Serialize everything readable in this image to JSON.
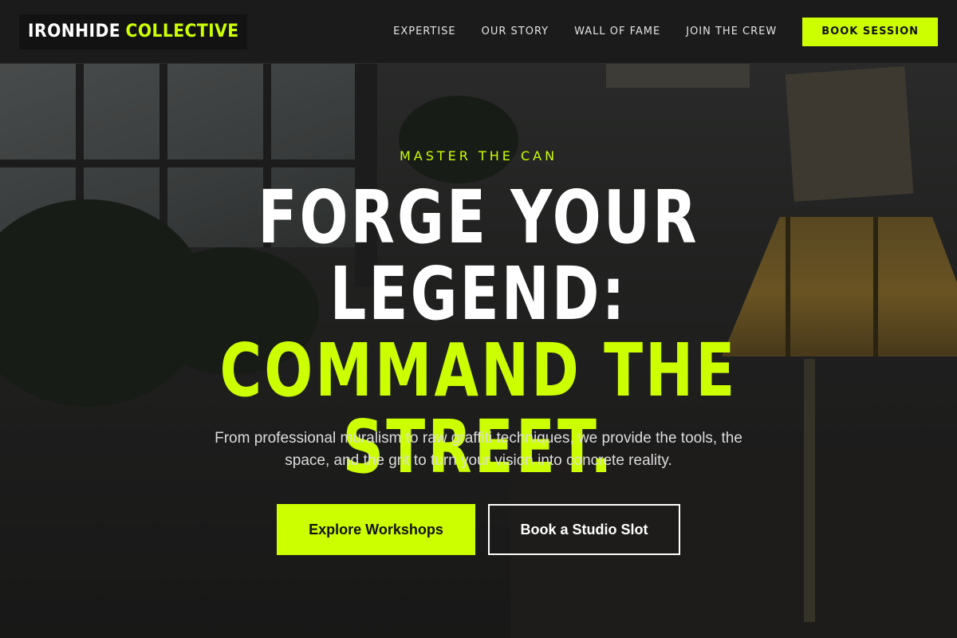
{
  "header": {
    "logo_part1": "IRONHIDE",
    "logo_part2": "COLLECTIVE",
    "nav": [
      "EXPERTISE",
      "OUR STORY",
      "WALL OF FAME",
      "JOIN THE CREW"
    ],
    "cta_label": "BOOK SESSION"
  },
  "hero": {
    "eyebrow": "MASTER THE CAN",
    "headline_line1": "FORGE YOUR LEGEND:",
    "headline_line2": "COMMAND THE",
    "headline_line3": "STREET.",
    "subtext": "From professional muralism to raw graffiti techniques, we provide the tools, the space, and the grit to turn your vision into concrete reality.",
    "primary_button": "Explore Workshops",
    "secondary_button": "Book a Studio Slot"
  },
  "colors": {
    "accent": "#ccff00",
    "header_bg": "#1b1b1b",
    "text_light": "#ffffff"
  }
}
